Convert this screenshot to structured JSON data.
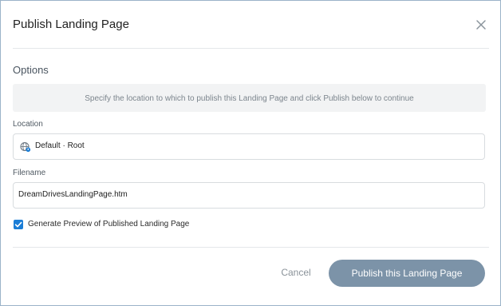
{
  "dialog": {
    "title": "Publish Landing Page",
    "close_icon": "close-icon"
  },
  "options": {
    "section_title": "Options",
    "info_text": "Specify the location to which to publish this Landing Page and click Publish below to continue"
  },
  "location": {
    "label": "Location",
    "value": "Default · Root",
    "icon": "globe-location-icon"
  },
  "filename": {
    "label": "Filename",
    "value": "DreamDrivesLandingPage.htm"
  },
  "preview_checkbox": {
    "label": "Generate Preview of Published Landing Page",
    "checked": true,
    "color": "#1a7dd6"
  },
  "footer": {
    "cancel_label": "Cancel",
    "publish_label": "Publish this Landing Page",
    "publish_color": "#7c93a8"
  }
}
